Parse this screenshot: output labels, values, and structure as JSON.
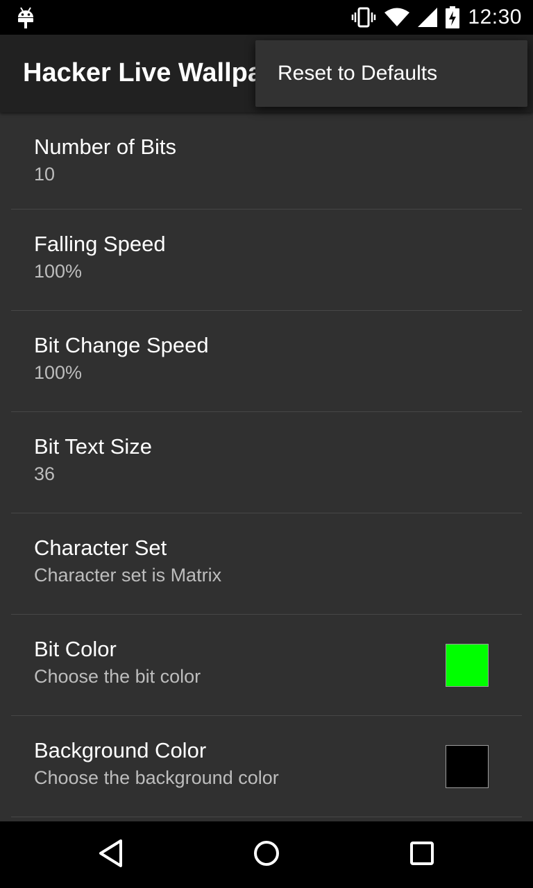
{
  "status_bar": {
    "time": "12:30",
    "icons": [
      "android-debug-icon",
      "vibrate-icon",
      "wifi-icon",
      "cell-signal-icon",
      "battery-charging-icon"
    ]
  },
  "action_bar": {
    "title": "Hacker Live Wallpaper"
  },
  "overflow_menu": {
    "items": [
      {
        "label": "Reset to Defaults"
      }
    ]
  },
  "preferences": [
    {
      "title": "Number of Bits",
      "summary": "10"
    },
    {
      "title": "Falling Speed",
      "summary": "100%"
    },
    {
      "title": "Bit Change Speed",
      "summary": "100%"
    },
    {
      "title": "Bit Text Size",
      "summary": "36"
    },
    {
      "title": "Character Set",
      "summary": "Character set is Matrix"
    },
    {
      "title": "Bit Color",
      "summary": "Choose the bit color",
      "color": "#00ff00"
    },
    {
      "title": "Background Color",
      "summary": "Choose the background color",
      "color": "#000000"
    }
  ],
  "nav_bar": {
    "buttons": [
      "back-icon",
      "home-icon",
      "recents-icon"
    ]
  },
  "colors": {
    "background": "#303030",
    "action_bar": "#212121",
    "popup": "#323232",
    "text_primary": "#ffffff",
    "text_secondary": "#bdbdbd"
  }
}
